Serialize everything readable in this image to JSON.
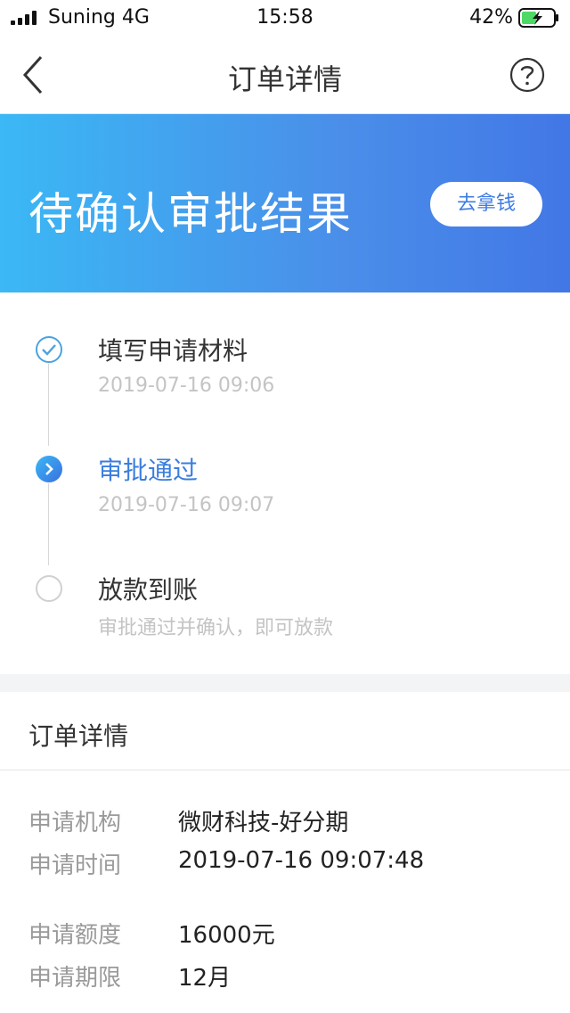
{
  "status_bar": {
    "carrier": "Suning 4G",
    "time": "15:58",
    "battery": "42%"
  },
  "nav": {
    "title": "订单详情",
    "back_icon": "chevron-left-icon",
    "help_icon": "question-circle-icon"
  },
  "banner": {
    "title": "待确认审批结果",
    "button_label": "去拿钱"
  },
  "timeline": [
    {
      "title": "填写申请材料",
      "subtitle": "2019-07-16 09:06",
      "state": "done"
    },
    {
      "title": "审批通过",
      "subtitle": "2019-07-16 09:07",
      "state": "current"
    },
    {
      "title": "放款到账",
      "subtitle": "审批通过并确认，即可放款",
      "state": "pending"
    }
  ],
  "order_details": {
    "title": "订单详情",
    "rows": [
      {
        "label": "申请机构",
        "value": "微财科技-好分期"
      },
      {
        "label": "申请时间",
        "value": "2019-07-16 09:07:48"
      },
      {
        "label": "申请额度",
        "value": "16000元"
      },
      {
        "label": "申请期限",
        "value": "12月"
      }
    ]
  },
  "colors": {
    "accent": "#3a7ddf",
    "banner_start": "#3bb8f5",
    "banner_end": "#4277e6",
    "battery_fill": "#4cd964"
  }
}
